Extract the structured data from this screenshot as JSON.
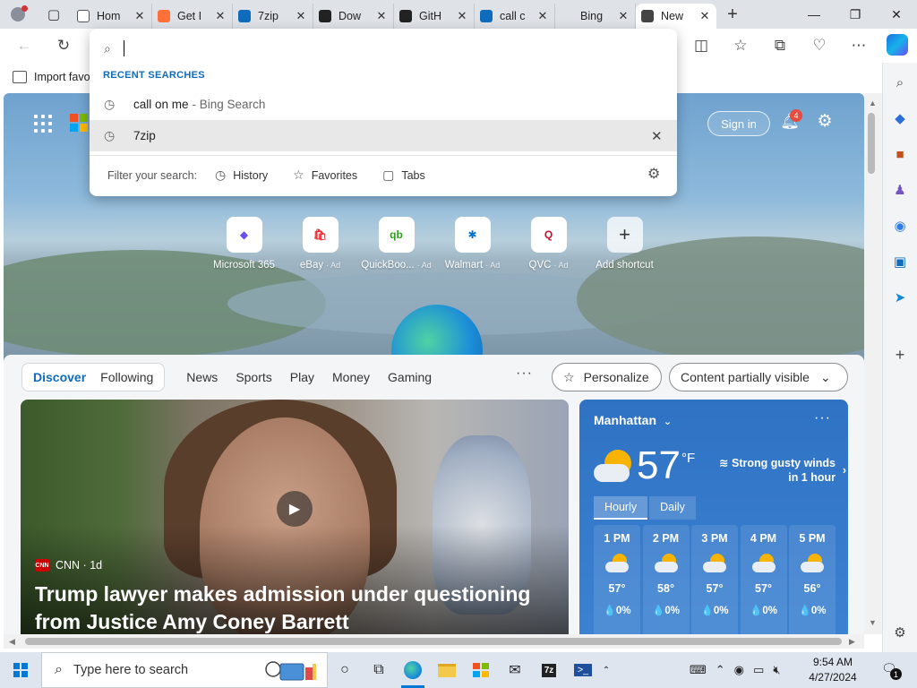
{
  "tabs": [
    {
      "label": "Hom",
      "favicon": "page-icon",
      "color": "#ffffff"
    },
    {
      "label": "Get I",
      "favicon": "firefox-icon",
      "color": "#ff7139"
    },
    {
      "label": "7zip",
      "favicon": "search-icon",
      "color": "#0f6cbd"
    },
    {
      "label": "Dow",
      "favicon": "7zip-icon",
      "color": "#222222"
    },
    {
      "label": "GitH",
      "favicon": "github-icon",
      "color": "#222222"
    },
    {
      "label": "call c",
      "favicon": "search-icon",
      "color": "#0f6cbd"
    },
    {
      "label": "Bing",
      "favicon": "",
      "color": "#dfe3e8"
    },
    {
      "label": "New",
      "favicon": "newtab-icon",
      "color": "#444444"
    }
  ],
  "favbar": {
    "import_label": "Import favo"
  },
  "dropdown": {
    "recent_heading": "RECENT SEARCHES",
    "items": [
      {
        "text": "call on me",
        "sub": "- Bing Search"
      },
      {
        "text": "7zip",
        "sub": ""
      }
    ],
    "filter_label": "Filter your search:",
    "filters": [
      "History",
      "Favorites",
      "Tabs"
    ]
  },
  "header": {
    "signin": "Sign in",
    "notif_count": "4"
  },
  "shortcuts": [
    {
      "label": "Microsoft 365",
      "ad": "",
      "icon": "m365-icon",
      "glyph": "◆",
      "color": "#6a4cf5"
    },
    {
      "label": "eBay",
      "ad": "· Ad",
      "icon": "ebay-icon",
      "glyph": "🛍",
      "color": "#e53238"
    },
    {
      "label": "QuickBoo...",
      "ad": "· Ad",
      "icon": "quickbooks-icon",
      "glyph": "qb",
      "color": "#2ca01c"
    },
    {
      "label": "Walmart",
      "ad": "· Ad",
      "icon": "walmart-icon",
      "glyph": "✱",
      "color": "#0071ce"
    },
    {
      "label": "QVC",
      "ad": "· Ad",
      "icon": "qvc-icon",
      "glyph": "Q",
      "color": "#c8102e"
    },
    {
      "label": "Add shortcut",
      "ad": "",
      "icon": "plus-icon",
      "glyph": "+",
      "color": "#333333"
    }
  ],
  "feed": {
    "tabs_boxed": [
      "Discover",
      "Following"
    ],
    "tabs": [
      "News",
      "Sports",
      "Play",
      "Money",
      "Gaming"
    ],
    "personalize": "Personalize",
    "content_visibility": "Content partially visible"
  },
  "story": {
    "source": "CNN · 1d",
    "headline": "Trump lawyer makes admission under questioning from Justice Amy Coney Barrett"
  },
  "weather": {
    "location": "Manhattan",
    "temp": "57",
    "unit": "°F",
    "condition": "Strong gusty winds in 1 hour",
    "tabs": [
      "Hourly",
      "Daily"
    ],
    "hours": [
      {
        "time": "1 PM",
        "temp": "57°",
        "precip": "💧0%"
      },
      {
        "time": "2 PM",
        "temp": "58°",
        "precip": "💧0%"
      },
      {
        "time": "3 PM",
        "temp": "57°",
        "precip": "💧0%"
      },
      {
        "time": "4 PM",
        "temp": "57°",
        "precip": "💧0%"
      },
      {
        "time": "5 PM",
        "temp": "56°",
        "precip": "💧0%"
      }
    ]
  },
  "taskbar": {
    "search_placeholder": "Type here to search",
    "time": "9:54 AM",
    "date": "4/27/2024",
    "notif_count": "1"
  }
}
